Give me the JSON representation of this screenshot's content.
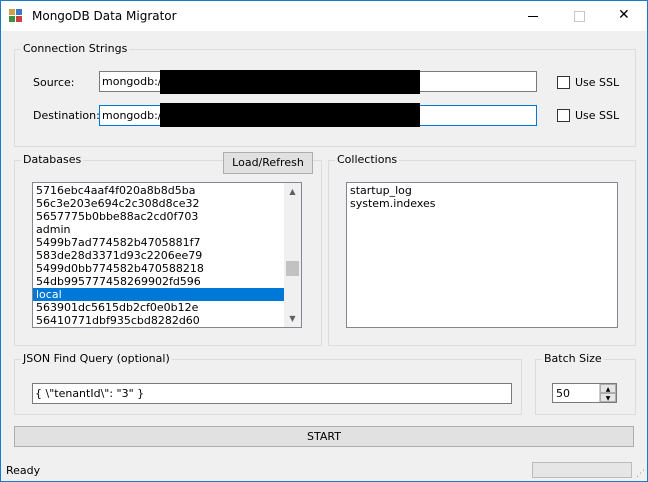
{
  "window": {
    "title": "MongoDB Data Migrator",
    "minimize_glyph": "",
    "maximize_glyph": "",
    "close_glyph": "✕"
  },
  "connection": {
    "group_label": "Connection Strings",
    "source_label": "Source:",
    "source_value": "mongodb://",
    "destination_label": "Destination:",
    "destination_value": "mongodb://",
    "use_ssl_label": "Use SSL",
    "source_ssl_checked": false,
    "destination_ssl_checked": false
  },
  "databases": {
    "group_label": "Databases",
    "load_button": "Load/Refresh",
    "items": [
      "5716ebc4aaf4f020a8b8d5ba",
      "56c3e203e694c2c308d8ce32",
      "5657775b0bbe88ac2cd0f703",
      "admin",
      "5499b7ad774582b4705881f7",
      "583de28d3371d93c2206ee79",
      "5499d0bb774582b470588218",
      "54db995777458269902fd596",
      "local",
      "563901dc5615db2cf0e0b12e",
      "56410771dbf935cbd8282d60"
    ],
    "selected_index": 8
  },
  "collections": {
    "group_label": "Collections",
    "items": [
      "startup_log",
      "system.indexes"
    ]
  },
  "query": {
    "group_label": "JSON Find Query (optional)",
    "value": "{ \\\"tenantId\\\": \"3\" }"
  },
  "batch": {
    "group_label": "Batch Size",
    "value": "50"
  },
  "start_button": "START",
  "status": {
    "text": "Ready",
    "progress": 0
  },
  "icons": {
    "app": "app-icon",
    "up": "▲",
    "down": "▼"
  },
  "colors": {
    "accent": "#0078d7",
    "window_border": "#1979ca"
  }
}
